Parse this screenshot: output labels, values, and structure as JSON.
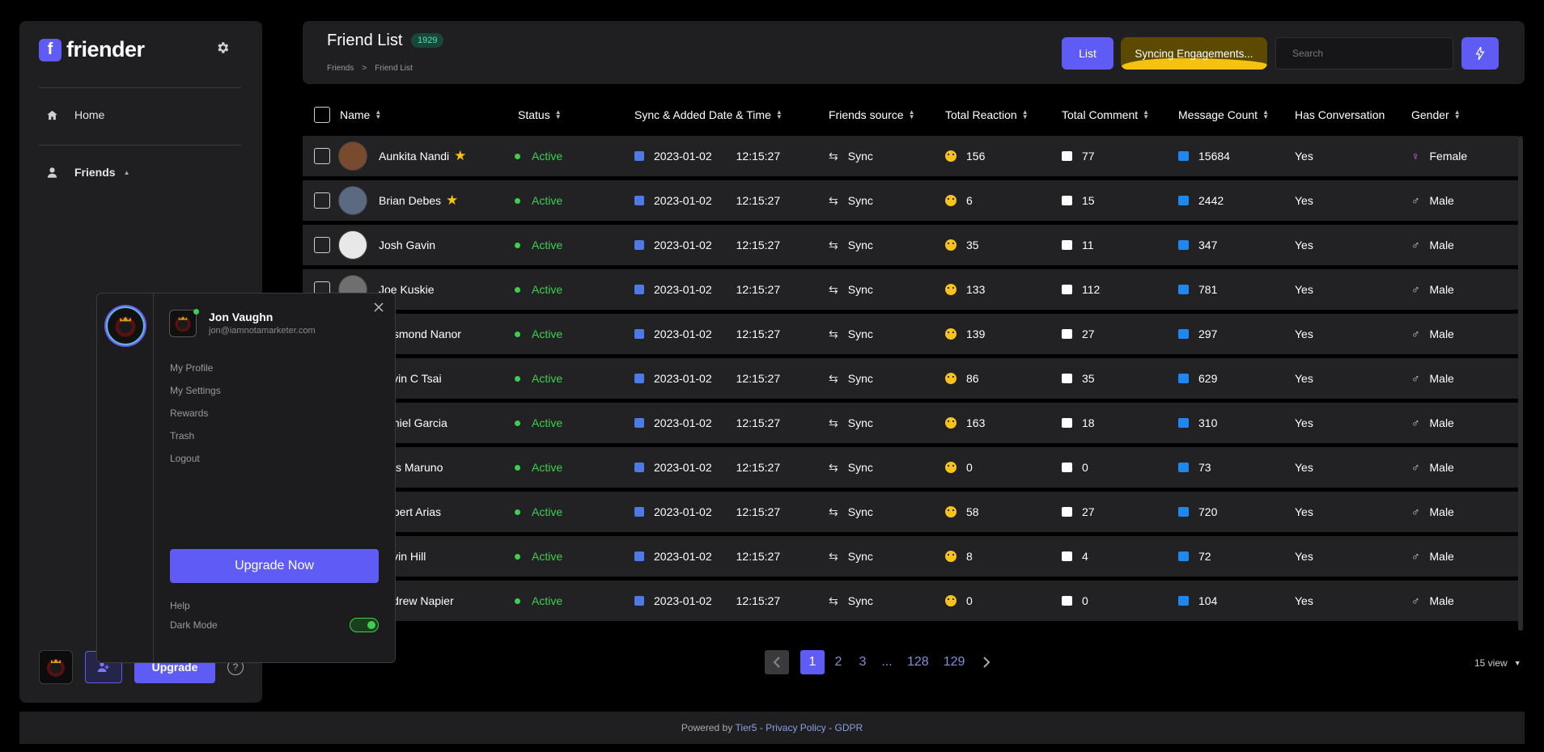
{
  "sidebar": {
    "logo_letter": "f",
    "logo_text": "friender",
    "nav": [
      {
        "label": "Home",
        "icon": "home-icon"
      },
      {
        "label": "Friends",
        "icon": "user-icon"
      }
    ],
    "upgrade_label": "Upgrade",
    "help_icon": "?"
  },
  "header": {
    "title": "Friend List",
    "count": "1929",
    "breadcrumbs": [
      "Friends",
      ">",
      "Friend List"
    ],
    "list_label": "List",
    "sync_label": "Syncing Engagements...",
    "search_placeholder": "Search"
  },
  "table": {
    "columns": [
      "Name",
      "Status",
      "Sync & Added Date & Time",
      "Friends source",
      "Total Reaction",
      "Total Comment",
      "Message Count",
      "Has Conversation",
      "Gender"
    ],
    "rows": [
      {
        "name": "Aunkita Nandi",
        "star": true,
        "status": "Active",
        "date": "2023-01-02",
        "time": "12:15:27",
        "source": "Sync",
        "reaction": "156",
        "comment": "77",
        "messages": "15684",
        "conversation": "Yes",
        "gender": "Female"
      },
      {
        "name": "Brian Debes",
        "star": true,
        "status": "Active",
        "date": "2023-01-02",
        "time": "12:15:27",
        "source": "Sync",
        "reaction": "6",
        "comment": "15",
        "messages": "2442",
        "conversation": "Yes",
        "gender": "Male"
      },
      {
        "name": "Josh Gavin",
        "star": false,
        "status": "Active",
        "date": "2023-01-02",
        "time": "12:15:27",
        "source": "Sync",
        "reaction": "35",
        "comment": "11",
        "messages": "347",
        "conversation": "Yes",
        "gender": "Male"
      },
      {
        "name": "Joe Kuskie",
        "star": false,
        "status": "Active",
        "date": "2023-01-02",
        "time": "12:15:27",
        "source": "Sync",
        "reaction": "133",
        "comment": "112",
        "messages": "781",
        "conversation": "Yes",
        "gender": "Male"
      },
      {
        "name": "Desmond Nanor",
        "star": false,
        "status": "Active",
        "date": "2023-01-02",
        "time": "12:15:27",
        "source": "Sync",
        "reaction": "139",
        "comment": "27",
        "messages": "297",
        "conversation": "Yes",
        "gender": "Male"
      },
      {
        "name": "Kevin C Tsai",
        "star": false,
        "status": "Active",
        "date": "2023-01-02",
        "time": "12:15:27",
        "source": "Sync",
        "reaction": "86",
        "comment": "35",
        "messages": "629",
        "conversation": "Yes",
        "gender": "Male"
      },
      {
        "name": "Daniel Garcia",
        "star": false,
        "status": "Active",
        "date": "2023-01-02",
        "time": "12:15:27",
        "source": "Sync",
        "reaction": "163",
        "comment": "18",
        "messages": "310",
        "conversation": "Yes",
        "gender": "Male"
      },
      {
        "name": "Ems Maruno",
        "star": false,
        "status": "Active",
        "date": "2023-01-02",
        "time": "12:15:27",
        "source": "Sync",
        "reaction": "0",
        "comment": "0",
        "messages": "73",
        "conversation": "Yes",
        "gender": "Male"
      },
      {
        "name": "Robert Arias",
        "star": false,
        "status": "Active",
        "date": "2023-01-02",
        "time": "12:15:27",
        "source": "Sync",
        "reaction": "58",
        "comment": "27",
        "messages": "720",
        "conversation": "Yes",
        "gender": "Male"
      },
      {
        "name": "Kevin Hill",
        "star": false,
        "status": "Active",
        "date": "2023-01-02",
        "time": "12:15:27",
        "source": "Sync",
        "reaction": "8",
        "comment": "4",
        "messages": "72",
        "conversation": "Yes",
        "gender": "Male"
      },
      {
        "name": "Andrew Napier",
        "star": false,
        "status": "Active",
        "date": "2023-01-02",
        "time": "12:15:27",
        "source": "Sync",
        "reaction": "0",
        "comment": "0",
        "messages": "104",
        "conversation": "Yes",
        "gender": "Male"
      }
    ]
  },
  "pagination": {
    "pages": [
      "1",
      "2",
      "3",
      "...",
      "128",
      "129"
    ],
    "current": "1",
    "view": "15 view"
  },
  "footer": {
    "prefix": "Powered by",
    "brand": "Tier5",
    "sep1": " - ",
    "privacy": "Privacy Policy",
    "sep2": " - ",
    "gdpr": "GDPR"
  },
  "profile_popup": {
    "name": "Jon Vaughn",
    "email": "jon@iamnotamarketer.com",
    "menu": [
      "My Profile",
      "My Settings",
      "Rewards",
      "Trash",
      "Logout"
    ],
    "upgrade_label": "Upgrade Now",
    "help_label": "Help",
    "dark_mode_label": "Dark Mode",
    "dark_mode_on": true
  },
  "colors": {
    "accent": "#5e5cf5",
    "active": "#3ecf50",
    "star": "#f7c21b",
    "sync_fill": "#f5c211"
  }
}
